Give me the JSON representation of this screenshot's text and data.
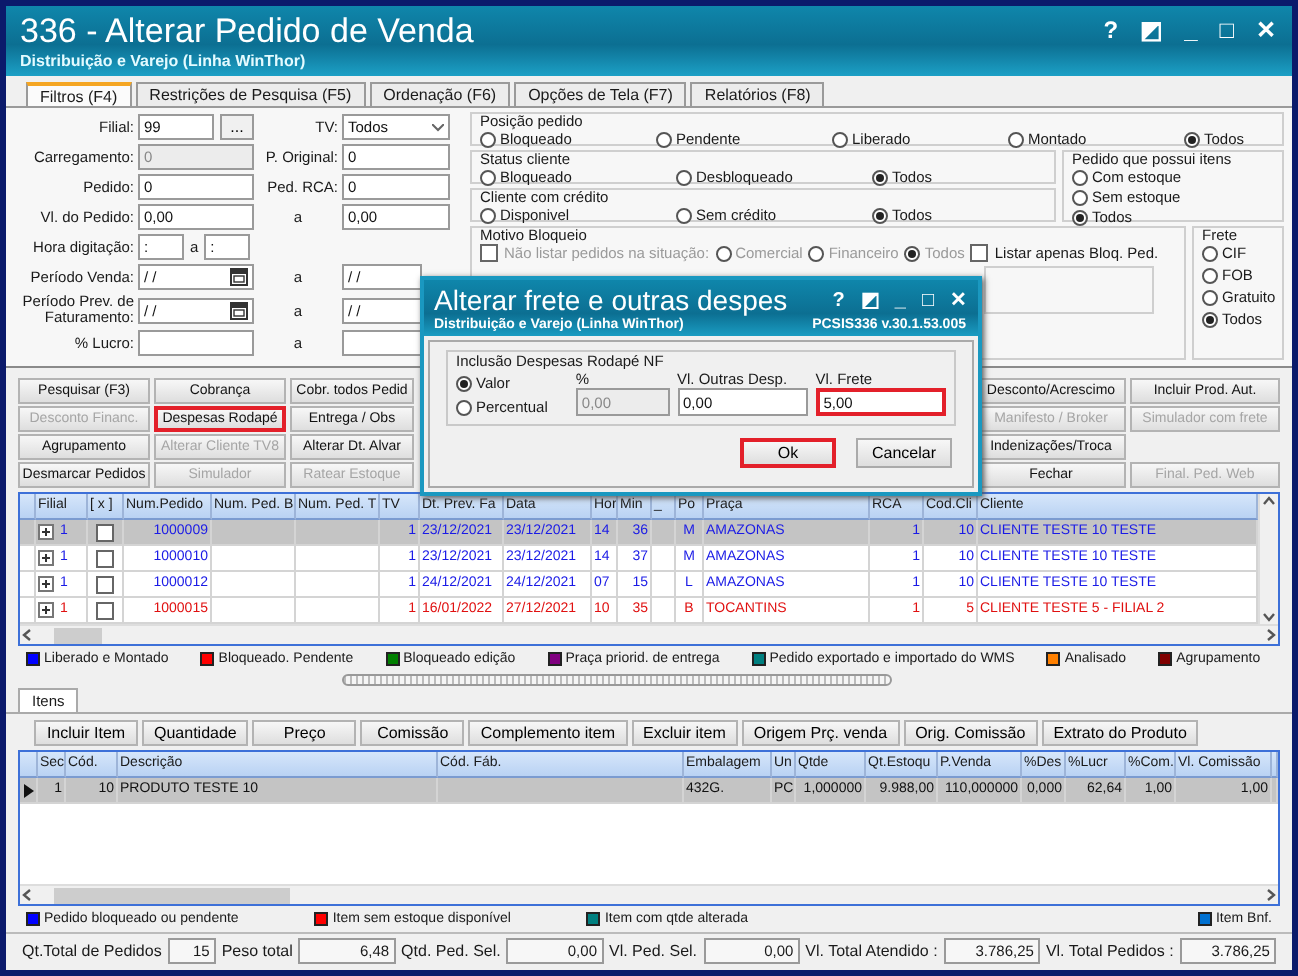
{
  "window": {
    "title": "336 - Alterar Pedido de Venda",
    "subtitle": "Distribuição e Varejo (Linha WinThor)",
    "controls": [
      "?",
      "◩",
      "_",
      "□",
      "✕"
    ]
  },
  "tabs": [
    {
      "label": "Filtros (F4)",
      "selected": true
    },
    {
      "label": "Restrições de Pesquisa (F5)",
      "selected": false
    },
    {
      "label": "Ordenação (F6)",
      "selected": false
    },
    {
      "label": "Opções de Tela (F7)",
      "selected": false
    },
    {
      "label": "Relatórios (F8)",
      "selected": false
    }
  ],
  "form": [
    {
      "kind": "filial",
      "label": "Filial:",
      "value": "99",
      "button": "...",
      "label2": "TV:",
      "value2": "Todos"
    },
    {
      "kind": "pair",
      "label": "Carregamento:",
      "value": "0",
      "disabled": true,
      "label2": "P. Original:",
      "value2": "0"
    },
    {
      "kind": "pair",
      "label": "Pedido:",
      "value": "0",
      "disabled": false,
      "label2": "Ped. RCA:",
      "value2": "0"
    },
    {
      "kind": "pair",
      "label": "Vl. do Pedido:",
      "value": "0,00",
      "disabled": false,
      "label2": "a",
      "value2": "0,00"
    },
    {
      "kind": "time",
      "label": "Hora digitação:",
      "value": ":",
      "label2": "a",
      "value2": ":"
    },
    {
      "kind": "date",
      "label": "Período Venda:",
      "value": "/ /",
      "label2": "a",
      "value2": "/ /"
    },
    {
      "kind": "date",
      "label": "Período Prev. de Faturamento:",
      "value": "/ /",
      "label2": "a",
      "value2": "/ /"
    },
    {
      "kind": "pair",
      "label": "% Lucro:",
      "disabled": false,
      "label2": "a"
    }
  ],
  "radio_groups": [
    {
      "title": "Posição pedido",
      "options": [
        {
          "label": "Bloqueado",
          "selected": false
        },
        {
          "label": "Pendente",
          "selected": false
        },
        {
          "label": "Liberado",
          "selected": false
        },
        {
          "label": "Montado",
          "selected": false
        },
        {
          "label": "Todos",
          "selected": true
        }
      ]
    },
    {
      "title": "Status cliente",
      "options": [
        {
          "label": "Bloqueado",
          "selected": false
        },
        {
          "label": "Desbloqueado",
          "selected": false
        },
        {
          "label": "Todos",
          "selected": true
        }
      ]
    },
    {
      "title": "Cliente com crédito",
      "options": [
        {
          "label": "Disponivel",
          "selected": false
        },
        {
          "label": "Sem crédito",
          "selected": false
        },
        {
          "label": "Todos",
          "selected": true
        }
      ]
    },
    {
      "title": "Pedido que possui itens",
      "options": [
        {
          "label": "Com estoque",
          "selected": false
        },
        {
          "label": "Sem estoque",
          "selected": false
        },
        {
          "label": "Todos",
          "selected": true
        }
      ]
    },
    {
      "title": "Frete",
      "options": [
        {
          "label": "CIF",
          "selected": false
        },
        {
          "label": "FOB",
          "selected": false
        },
        {
          "label": "Gratuito",
          "selected": false
        },
        {
          "label": "Todos",
          "selected": true
        }
      ]
    }
  ],
  "motivo_bloqueio": {
    "title": "Motivo Bloqueio",
    "checkbox": {
      "label": "Não listar pedidos na situação:",
      "checked": false
    },
    "disabled": true,
    "options": [
      {
        "label": "Comercial",
        "selected": false
      },
      {
        "label": "Financeiro",
        "selected": false
      },
      {
        "label": "Todos",
        "selected": true
      }
    ],
    "extra_checkbox": {
      "label": "Listar apenas Bloq. Ped.",
      "checked": false
    }
  },
  "action_buttons": [
    [
      {
        "label": "Pesquisar (F3)",
        "disabled": false,
        "highlighted": false
      },
      {
        "label": "Cobrança",
        "disabled": false,
        "highlighted": false
      },
      {
        "label": "Cobr. todos Pedid",
        "disabled": false,
        "highlighted": false
      },
      {
        "label": "Desconto/Acrescimo",
        "disabled": false,
        "highlighted": false
      },
      {
        "label": "Incluir Prod. Aut.",
        "disabled": false,
        "highlighted": false
      }
    ],
    [
      {
        "label": "Desconto Financ.",
        "disabled": true,
        "highlighted": false
      },
      {
        "label": "Despesas Rodapé",
        "disabled": false,
        "highlighted": true
      },
      {
        "label": "Entrega / Obs",
        "disabled": false,
        "highlighted": false
      },
      {
        "label": "Manifesto / Broker",
        "disabled": true,
        "highlighted": false
      },
      {
        "label": "Simulador com frete",
        "disabled": true,
        "highlighted": false
      }
    ],
    [
      {
        "label": "Agrupamento",
        "disabled": false,
        "highlighted": false
      },
      {
        "label": "Alterar Cliente TV8",
        "disabled": true,
        "highlighted": false
      },
      {
        "label": "Alterar Dt. Alvar",
        "disabled": false,
        "highlighted": false
      },
      {
        "label": "Indenizações/Troca",
        "disabled": false,
        "highlighted": false
      }
    ],
    [
      {
        "label": "Desmarcar Pedidos",
        "disabled": false,
        "highlighted": false
      },
      {
        "label": "Simulador",
        "disabled": true,
        "highlighted": false
      },
      {
        "label": "Ratear Estoque",
        "disabled": true,
        "highlighted": false
      },
      {
        "label": "Fechar",
        "disabled": false,
        "highlighted": false
      },
      {
        "label": "Final. Ped. Web",
        "disabled": true,
        "highlighted": false
      }
    ]
  ],
  "orders": {
    "columns": [
      "Filial",
      "[ x ]",
      "Num.Pedido",
      "Num. Ped. B",
      "Num. Ped. T",
      "TV",
      "Dt. Prev. Fa",
      "Data",
      "Hor",
      "Min",
      "_",
      "Po",
      "Praça",
      "RCA",
      "Cod.Cli",
      "Cliente"
    ],
    "rows": [
      {
        "selected": true,
        "color": "#1a1ae6",
        "checked": false,
        "expanded": false,
        "cells": [
          "1",
          null,
          "1000009",
          null,
          null,
          "1",
          "23/12/2021",
          "23/12/2021",
          "14",
          "36",
          null,
          "M",
          "AMAZONAS",
          "1",
          "10",
          "CLIENTE TESTE 10 TESTE"
        ]
      },
      {
        "selected": false,
        "color": "#1a1ae6",
        "checked": false,
        "expanded": false,
        "cells": [
          "1",
          null,
          "1000010",
          null,
          null,
          "1",
          "23/12/2021",
          "23/12/2021",
          "14",
          "37",
          null,
          "M",
          "AMAZONAS",
          "1",
          "10",
          "CLIENTE TESTE 10 TESTE"
        ]
      },
      {
        "selected": false,
        "color": "#1a1ae6",
        "checked": false,
        "expanded": false,
        "cells": [
          "1",
          null,
          "1000012",
          null,
          null,
          "1",
          "24/12/2021",
          "24/12/2021",
          "07",
          "15",
          null,
          "L",
          "AMAZONAS",
          "1",
          "10",
          "CLIENTE TESTE 10 TESTE"
        ]
      },
      {
        "selected": false,
        "color": "#e01010",
        "checked": false,
        "expanded": false,
        "cells": [
          "1",
          null,
          "1000015",
          null,
          null,
          "1",
          "16/01/2022",
          "27/12/2021",
          "10",
          "35",
          null,
          "B",
          "TOCANTINS",
          "1",
          "5",
          "CLIENTE TESTE 5  - FILIAL 2"
        ]
      }
    ]
  },
  "orders_legend": [
    {
      "label": "Liberado e Montado",
      "color": "#0000ff"
    },
    {
      "label": "Bloqueado. Pendente",
      "color": "#ff0000"
    },
    {
      "label": "Bloqueado edição",
      "color": "#008000"
    },
    {
      "label": "Praça priorid. de entrega",
      "color": "#800080"
    },
    {
      "label": "Pedido exportado e importado do WMS",
      "color": "#008080"
    },
    {
      "label": "Analisado",
      "color": "#ff8000"
    },
    {
      "label": "Agrupamento",
      "color": "#800000"
    }
  ],
  "items_tabs": [
    {
      "label": "Itens",
      "selected": true
    }
  ],
  "item_buttons": [
    "Incluir Item",
    "Quantidade",
    "Preço",
    "Comissão",
    "Complemento item",
    "Excluir item",
    "Origem Prç. venda",
    "Orig. Comissão",
    "Extrato do Produto"
  ],
  "items": {
    "columns": [
      "Sec",
      "Cód.",
      "Descrição",
      "Cód. Fáb.",
      "Embalagem",
      "Un",
      "Qtde",
      "Qt.Estoqu",
      "P.Venda",
      "%Des",
      "%Lucr",
      "%Com.",
      "Vl. Comissão"
    ],
    "rows": [
      {
        "selected": true,
        "cells": [
          "1",
          "10",
          "PRODUTO TESTE 10",
          null,
          "432G.",
          "PC",
          "1,000000",
          "9.988,00",
          "110,000000",
          "0,000",
          "62,64",
          "1,00",
          "1,00"
        ]
      }
    ]
  },
  "items_legend": [
    {
      "label": "Pedido bloqueado ou pendente",
      "color": "#0000ff"
    },
    {
      "label": "Item sem estoque disponível",
      "color": "#ff0000"
    },
    {
      "label": "Item com qtde alterada",
      "color": "#008080"
    },
    {
      "label": "Item Bnf.",
      "color": "#0070d0"
    }
  ],
  "totals": [
    {
      "label": "Qt.Total de Pedidos",
      "value": "15"
    },
    {
      "label": "Peso total",
      "value": "6,48"
    },
    {
      "label": "Qtd. Ped. Sel.",
      "value": "0,00"
    },
    {
      "label": "Vl. Ped. Sel.",
      "value": "0,00"
    },
    {
      "label": "Vl. Total Atendido :",
      "value": "3.786,25"
    },
    {
      "label": "Vl. Total Pedidos :",
      "value": "3.786,25"
    }
  ],
  "dialog": {
    "title": "Alterar frete e outras despes",
    "subtitle": "Distribuição e Varejo (Linha WinThor)",
    "version": "PCSIS336  v.30.1.53.005",
    "controls": [
      "?",
      "◩",
      "_",
      "□",
      "✕"
    ],
    "group_title": "Inclusão Despesas Rodapé NF",
    "options": [
      {
        "label": "Valor",
        "selected": true
      },
      {
        "label": "Percentual",
        "selected": false
      }
    ],
    "fields": [
      {
        "label": "%",
        "value": "0,00",
        "disabled": true,
        "highlighted": false
      },
      {
        "label": "Vl. Outras Desp.",
        "value": "0,00",
        "disabled": false,
        "highlighted": false
      },
      {
        "label": "Vl. Frete",
        "value": "5,00",
        "disabled": false,
        "highlighted": true
      }
    ],
    "buttons": [
      {
        "label": "Ok",
        "highlighted": true
      },
      {
        "label": "Cancelar",
        "highlighted": false
      }
    ]
  }
}
